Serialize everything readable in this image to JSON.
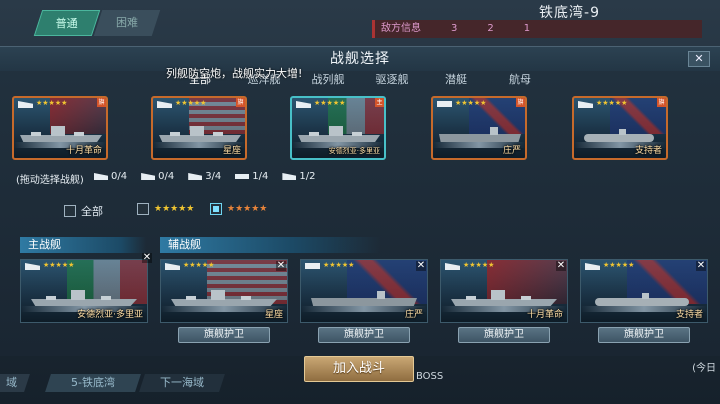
{
  "background": {
    "tab_normal": "普通",
    "tab_hard": "困难",
    "stage_title": "铁底湾-9",
    "enemy_info": "敌方信息",
    "enemy_counts": [
      "3",
      "2",
      "1"
    ],
    "nav_prev": "域",
    "nav_current": "5-铁底湾",
    "nav_next": "下一海域",
    "boss": "BOSS",
    "today": "(今日"
  },
  "modal": {
    "title": "战舰选择",
    "close": "✕",
    "toast": "列舰防空炮，战舰实力大增!",
    "tabs": [
      "全部",
      "巡洋舰",
      "战列舰",
      "驱逐舰",
      "潜艇",
      "航母"
    ],
    "cards": [
      {
        "name": "十月革命",
        "stars": "★★★★★",
        "flag": "ussr",
        "kind": "battleship",
        "corner": "旗"
      },
      {
        "name": "星座",
        "stars": "★★★★★",
        "flag": "us",
        "kind": "battleship",
        "corner": "旗"
      },
      {
        "name": "安德烈亚·多里亚",
        "stars": "★★★★★",
        "flag": "it",
        "kind": "battleship",
        "corner": "主"
      },
      {
        "name": "庄严",
        "stars": "★★★★★",
        "flag": "uk",
        "kind": "carrier",
        "corner": "旗"
      },
      {
        "name": "支持者",
        "stars": "★★★★★",
        "flag": "uk",
        "kind": "sub",
        "corner": "旗"
      }
    ],
    "drag_label": "(拖动选择战舰)",
    "counts": [
      "0/4",
      "0/4",
      "3/4",
      "1/4",
      "1/2"
    ],
    "filter_all": "全部",
    "filter_gold_stars": "★★★★★",
    "filter_orange_stars": "★★★★★",
    "main_ship_label": "主战舰",
    "escort_label": "辅战舰",
    "main_ship": {
      "name": "安德烈亚·多里亚",
      "stars": "★★★★★",
      "flag": "it"
    },
    "escorts": [
      {
        "name": "星座",
        "stars": "★★★★★",
        "flag": "us",
        "kind": "battleship"
      },
      {
        "name": "庄严",
        "stars": "★★★★★",
        "flag": "uk",
        "kind": "carrier"
      },
      {
        "name": "十月革命",
        "stars": "★★★★★",
        "flag": "ussr",
        "kind": "battleship"
      },
      {
        "name": "支持者",
        "stars": "★★★★★",
        "flag": "uk",
        "kind": "sub"
      }
    ],
    "escort_button": "旗舰护卫",
    "join_battle": "加入战斗"
  },
  "colors": {
    "card_border": "#c66a2b",
    "selected_border": "#48c0c8",
    "star_gold": "#f0c531",
    "star_orange": "#e8843a",
    "header_blue": "#2f7aa3"
  }
}
